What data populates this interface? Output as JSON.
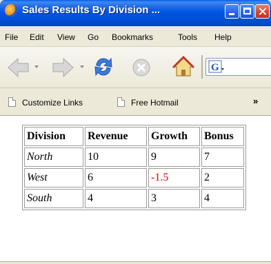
{
  "window": {
    "title": "Sales Results By Division ..."
  },
  "menu": [
    "File",
    "Edit",
    "View",
    "Go",
    "Bookmarks",
    "Tools",
    "Help"
  ],
  "bookmarks_bar": {
    "items": [
      "Customize Links",
      "Free Hotmail"
    ],
    "overflow": "»"
  },
  "table": {
    "headers": [
      "Division",
      "Revenue",
      "Growth",
      "Bonus"
    ],
    "rows": [
      [
        "North",
        "10",
        "9",
        "7"
      ],
      [
        "West",
        "6",
        "-1.5",
        "2"
      ],
      [
        "South",
        "4",
        "3",
        "4"
      ]
    ]
  },
  "colors": {
    "negative": "#e00000",
    "titlebar": "#0055e3"
  },
  "icons": [
    "firefox-icon",
    "back-icon",
    "forward-icon",
    "reload-icon",
    "stop-icon",
    "home-icon",
    "page-icon"
  ]
}
